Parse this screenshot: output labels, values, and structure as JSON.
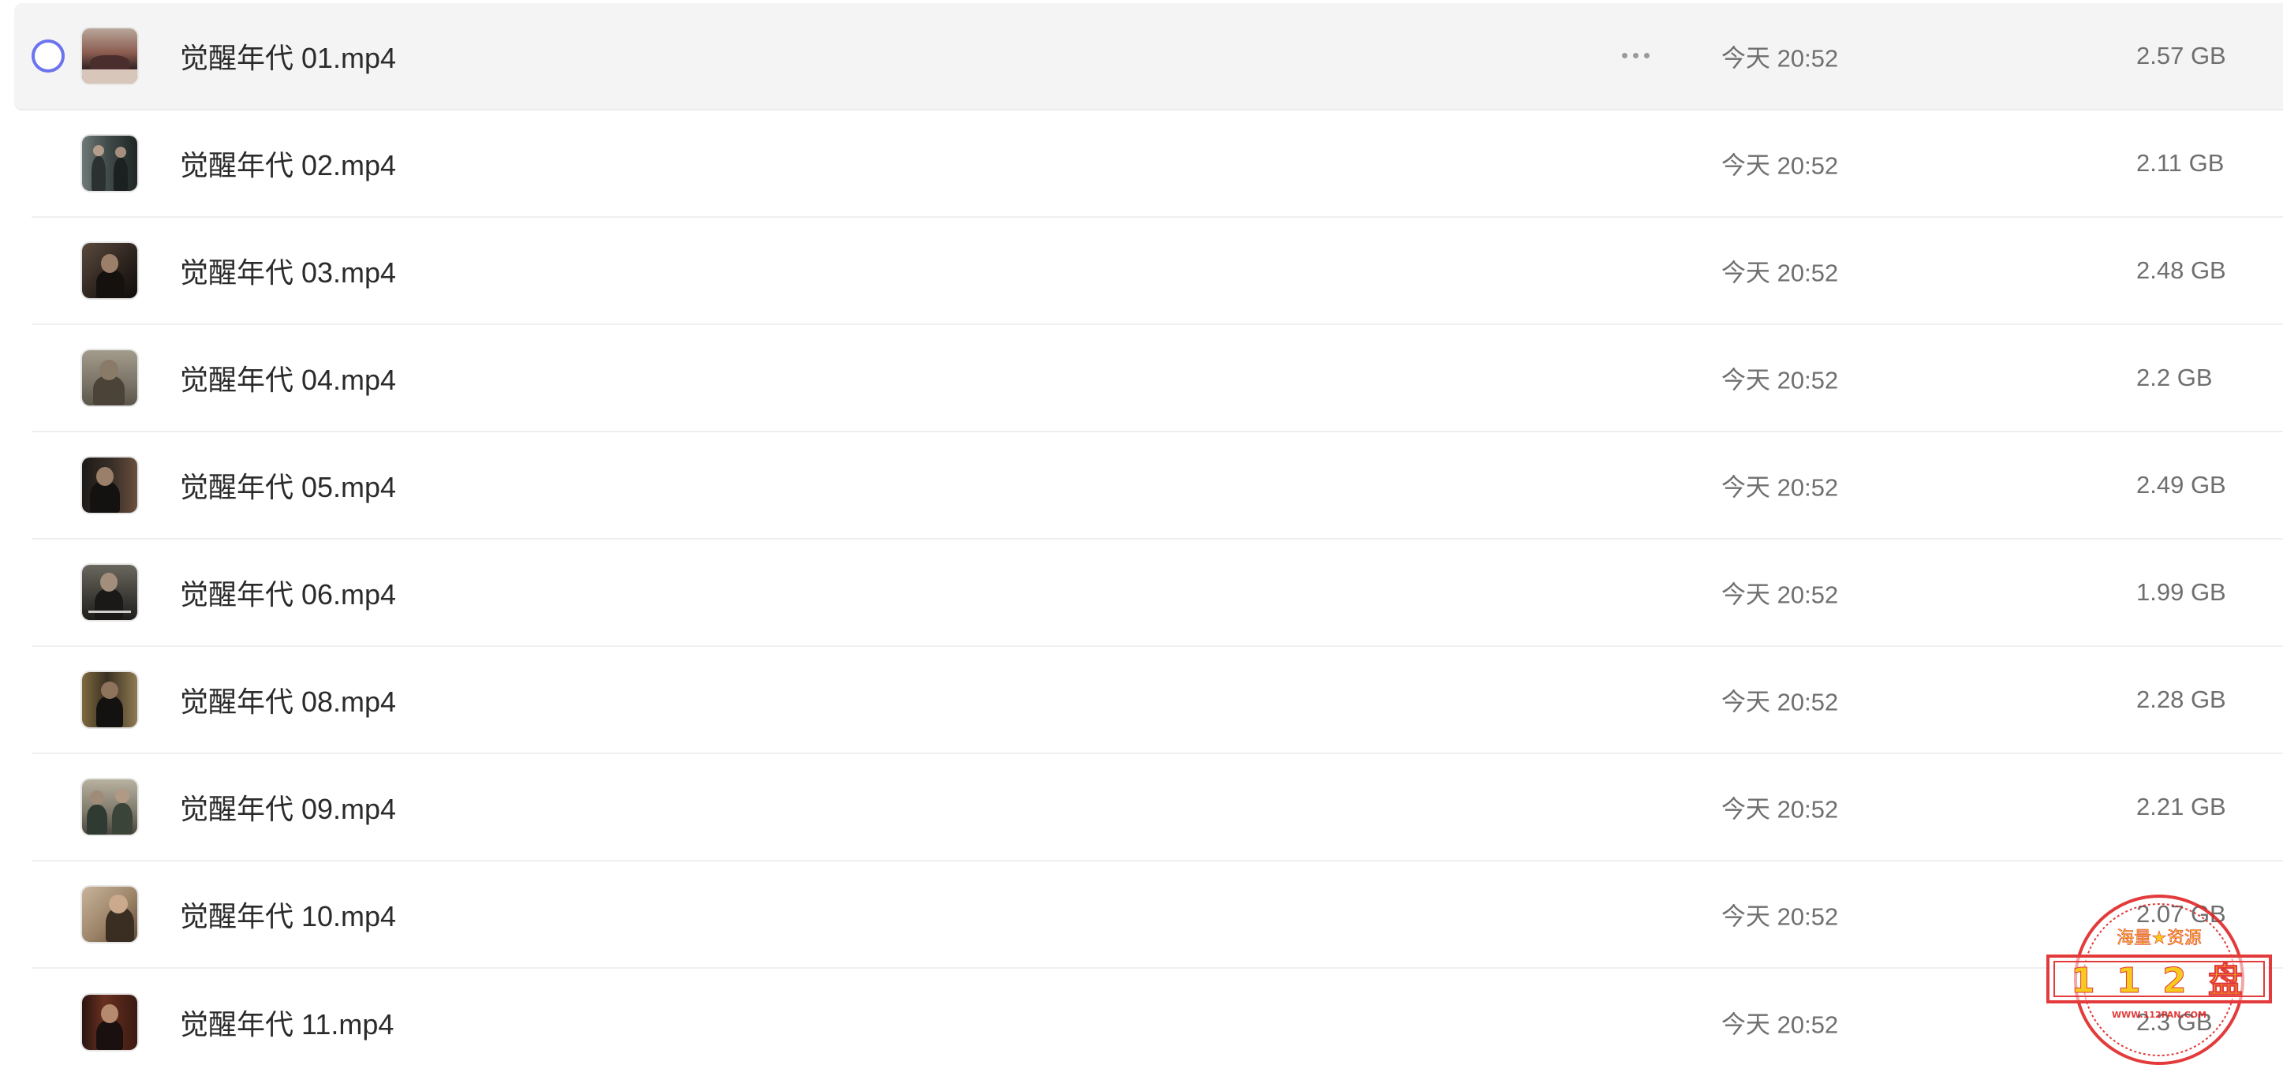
{
  "files": [
    {
      "name": "觉醒年代 01.mp4",
      "modified": "今天 20:52",
      "size": "2.57 GB",
      "hovered": true
    },
    {
      "name": "觉醒年代 02.mp4",
      "modified": "今天 20:52",
      "size": "2.11 GB"
    },
    {
      "name": "觉醒年代 03.mp4",
      "modified": "今天 20:52",
      "size": "2.48 GB"
    },
    {
      "name": "觉醒年代 04.mp4",
      "modified": "今天 20:52",
      "size": "2.2 GB"
    },
    {
      "name": "觉醒年代 05.mp4",
      "modified": "今天 20:52",
      "size": "2.49 GB"
    },
    {
      "name": "觉醒年代 06.mp4",
      "modified": "今天 20:52",
      "size": "1.99 GB"
    },
    {
      "name": "觉醒年代 08.mp4",
      "modified": "今天 20:52",
      "size": "2.28 GB"
    },
    {
      "name": "觉醒年代 09.mp4",
      "modified": "今天 20:52",
      "size": "2.21 GB"
    },
    {
      "name": "觉醒年代 10.mp4",
      "modified": "今天 20:52",
      "size": "2.07 GB"
    },
    {
      "name": "觉醒年代 11.mp4",
      "modified": "今天 20:52",
      "size": "2.3 GB"
    }
  ],
  "icons": {
    "select": "circle-select-icon",
    "more": "more-horizontal-icon"
  },
  "colors": {
    "accent": "#6b73ef",
    "hover_row": "#f4f4f4",
    "text_primary": "#2b2b2b",
    "text_secondary": "#6f6f6f",
    "seal_red": "#e02020",
    "seal_yellow": "#f5c400"
  },
  "watermark": {
    "top_text": "海量★资源",
    "main_text": "1 1 2 盘",
    "bottom_text": "WWW.112PAN.COM"
  }
}
